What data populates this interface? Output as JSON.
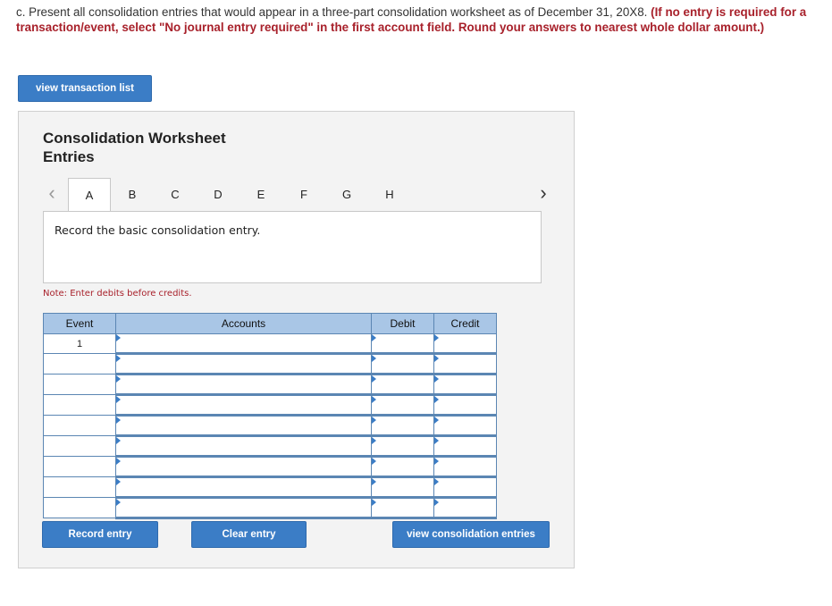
{
  "instructions": {
    "normal": "c. Present all consolidation entries that would appear in a three-part consolidation worksheet as of December 31, 20X8. ",
    "bold": "(If no entry is required for a transaction/event, select \"No journal entry required\" in the first account field. Round your answers to nearest whole dollar amount.)"
  },
  "buttons": {
    "view_transaction": "view transaction list",
    "record_entry": "Record entry",
    "clear_entry": "Clear entry",
    "view_consolidation": "view consolidation entries"
  },
  "panel": {
    "title": "Consolidation Worksheet Entries",
    "tabs": [
      "A",
      "B",
      "C",
      "D",
      "E",
      "F",
      "G",
      "H"
    ],
    "active_tab": "A",
    "prompt": "Record the basic consolidation entry.",
    "note": "Note: Enter debits before credits."
  },
  "table": {
    "headers": {
      "event": "Event",
      "accounts": "Accounts",
      "debit": "Debit",
      "credit": "Credit"
    },
    "rows": [
      {
        "event": "1",
        "account": "",
        "debit": "",
        "credit": ""
      },
      {
        "event": "",
        "account": "",
        "debit": "",
        "credit": ""
      },
      {
        "event": "",
        "account": "",
        "debit": "",
        "credit": ""
      },
      {
        "event": "",
        "account": "",
        "debit": "",
        "credit": ""
      },
      {
        "event": "",
        "account": "",
        "debit": "",
        "credit": ""
      },
      {
        "event": "",
        "account": "",
        "debit": "",
        "credit": ""
      },
      {
        "event": "",
        "account": "",
        "debit": "",
        "credit": ""
      },
      {
        "event": "",
        "account": "",
        "debit": "",
        "credit": ""
      },
      {
        "event": "",
        "account": "",
        "debit": "",
        "credit": ""
      }
    ]
  },
  "colors": {
    "button": "#3b7dc6",
    "header": "#a9c6e6",
    "accent_red": "#a8212b"
  }
}
